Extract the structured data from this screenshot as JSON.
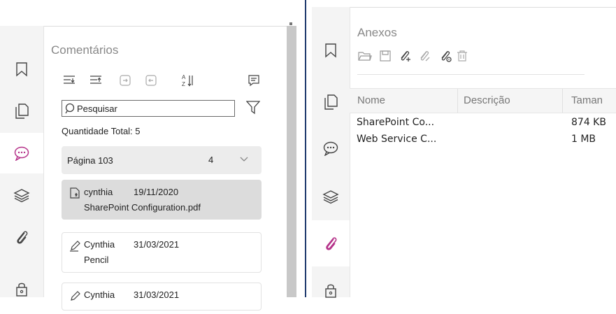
{
  "left": {
    "title": "Comentários",
    "search_placeholder": "Pesquisar",
    "total": "Quantidade Total: 5",
    "page_group": {
      "label": "Página 103",
      "count": "4"
    },
    "items": [
      {
        "author": "cynthia",
        "date": "19/11/2020",
        "text": "SharePoint Configuration.pdf",
        "icon": "attachment-note-icon"
      },
      {
        "author": "Cynthia",
        "date": "31/03/2021",
        "text": "Pencil",
        "icon": "pencil-icon"
      },
      {
        "author": "Cynthia",
        "date": "31/03/2021",
        "text": "",
        "icon": "pencil-icon"
      }
    ],
    "tabs": [
      "bookmark-icon",
      "pages-icon",
      "comments-icon",
      "layers-icon",
      "attachments-icon",
      "security-icon"
    ]
  },
  "right": {
    "title": "Anexos",
    "columns": [
      "Nome",
      "Descrição",
      "Taman"
    ],
    "rows": [
      {
        "name": "SharePoint Co...",
        "description": "",
        "size": "874 KB"
      },
      {
        "name": "Web Service C...",
        "description": "",
        "size": "1 MB"
      }
    ],
    "tabs": [
      "bookmark-icon",
      "pages-icon",
      "comments-icon",
      "layers-icon",
      "attachments-icon",
      "security-icon"
    ]
  },
  "colors": {
    "accent": "#b5338a",
    "divider": "#1f3a6e"
  }
}
